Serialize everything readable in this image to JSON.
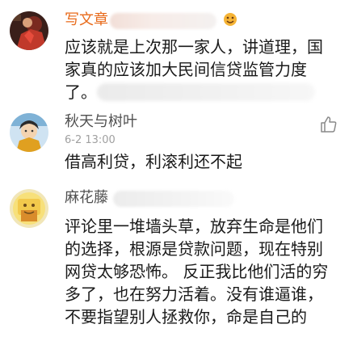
{
  "comments": [
    {
      "username": "写文章",
      "text_lines": [
        "应该就是上次那一家人，讲道理，国",
        "家真的应该加大民间信贷监管力度",
        "了。"
      ]
    },
    {
      "username": "秋天与树叶",
      "timestamp": "6-2 13:00",
      "text_lines": [
        "借高利贷，利滚利还不起"
      ]
    },
    {
      "username": "麻花藤",
      "text_lines": [
        "评论里一堆墙头草，放弃生命是他们",
        "的选择，根源是贷款问题，现在特别",
        "网贷太够恐怖。 反正我比他们活的穷",
        "多了，也在努力活着。没有谁逼谁，",
        "不要指望别人拯救你，命是自己的"
      ]
    }
  ],
  "icons": {
    "like": "thumbs-up-icon",
    "emoji": "smiley-emoji-icon"
  },
  "colors": {
    "username_highlight": "#e86a1a",
    "username_normal": "#505050",
    "text": "#1a1a1a",
    "meta": "#a0a0a0",
    "divider": "#e6e6e6"
  }
}
